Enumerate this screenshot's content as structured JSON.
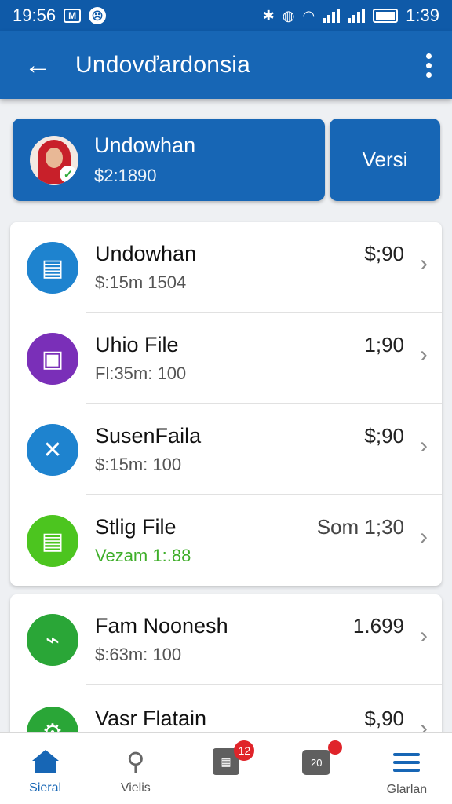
{
  "status_bar": {
    "time": "19:56",
    "battery_time": "1:39"
  },
  "app_bar": {
    "title": "Undovďardonsia"
  },
  "account": {
    "name": "Undowhan",
    "amount": "$2:1890",
    "action_label": "Versi"
  },
  "list_primary": [
    {
      "title": "Undowhan",
      "sub": "$:15m 1504",
      "amount": "$;90",
      "icon": "document-icon",
      "color": "#1e83cf"
    },
    {
      "title": "Uhio File",
      "sub": "Fl:35m: 100",
      "amount": "1;90",
      "icon": "window-icon",
      "color": "#7a2fb8"
    },
    {
      "title": "SusenFaila",
      "sub": "$:15m: 100",
      "amount": "$;90",
      "icon": "tools-icon",
      "color": "#1e83cf"
    },
    {
      "title": "Stlig File",
      "sub": "Vezam 1:.88",
      "amount": "Som 1;30",
      "icon": "sheet-icon",
      "color": "#4cc51f"
    }
  ],
  "list_secondary": [
    {
      "title": "Fam Noonesh",
      "sub": "$:63m: 100",
      "amount": "1.699",
      "icon": "chart-icon",
      "color": "#2aa637"
    },
    {
      "title": "Vasr Flatain",
      "sub": "",
      "amount": "$,90",
      "icon": "gear-icon",
      "color": "#2aa637"
    }
  ],
  "nav": [
    {
      "label": "Sieral",
      "icon": "home-icon"
    },
    {
      "label": "Vielis",
      "icon": "search-icon"
    },
    {
      "label": "",
      "icon": "calendar-icon",
      "badge": "12"
    },
    {
      "label": "",
      "icon": "chat-icon",
      "badge": "",
      "badge_icon_text": "20"
    },
    {
      "label": "Glarlan",
      "icon": "menu-icon"
    }
  ]
}
